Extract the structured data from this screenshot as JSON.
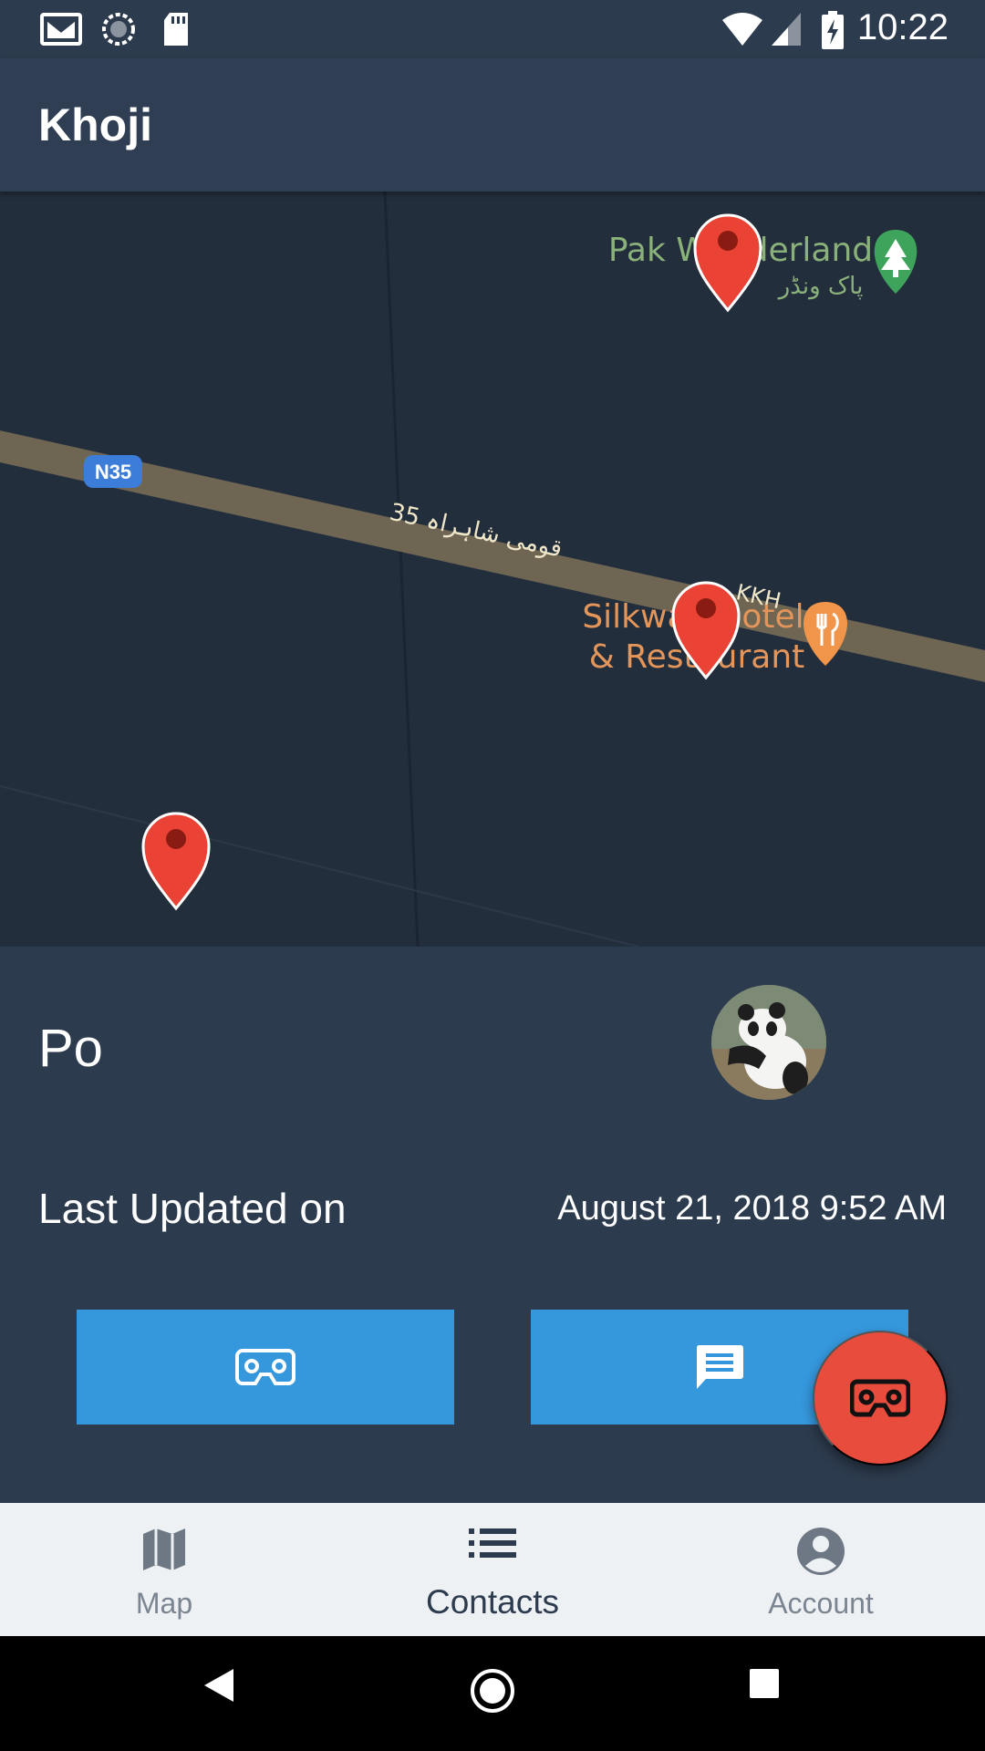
{
  "status_bar": {
    "time": "10:22",
    "left_icons": [
      "gmail-icon",
      "sync-icon",
      "sd-card-icon"
    ],
    "right_icons": [
      "wifi-icon",
      "signal-icon",
      "battery-charging-icon"
    ]
  },
  "app_bar": {
    "title": "Khoji"
  },
  "map": {
    "road_shield": "N35",
    "road_name_urdu": "قومی شاہراہ 35",
    "road_name_alt": "KKH",
    "place_1_name": "Pak Wonderland",
    "place_1_urdu": "پاک ونڈر",
    "place_2_name_line1": "Silkway Hotel",
    "place_2_name_line2": "& Restaurant",
    "markers": 3
  },
  "contact": {
    "name": "Po",
    "last_updated_label": "Last Updated on",
    "last_updated_value": "August 21, 2018 9:52 AM"
  },
  "actions": {
    "vr_button_icon": "vr-headset-icon",
    "message_button_icon": "message-icon",
    "fab_icon": "vr-headset-icon"
  },
  "bottom_nav": {
    "items": [
      {
        "label": "Map",
        "icon": "map-icon",
        "active": false
      },
      {
        "label": "Contacts",
        "icon": "list-icon",
        "active": true
      },
      {
        "label": "Account",
        "icon": "account-icon",
        "active": false
      }
    ]
  },
  "colors": {
    "background": "#2d3b4e",
    "map_bg": "#232e3c",
    "button_blue": "#3597dc",
    "fab_red": "#e74c3c",
    "marker_red": "#ea4335",
    "nav_bg": "#eef1f4"
  }
}
